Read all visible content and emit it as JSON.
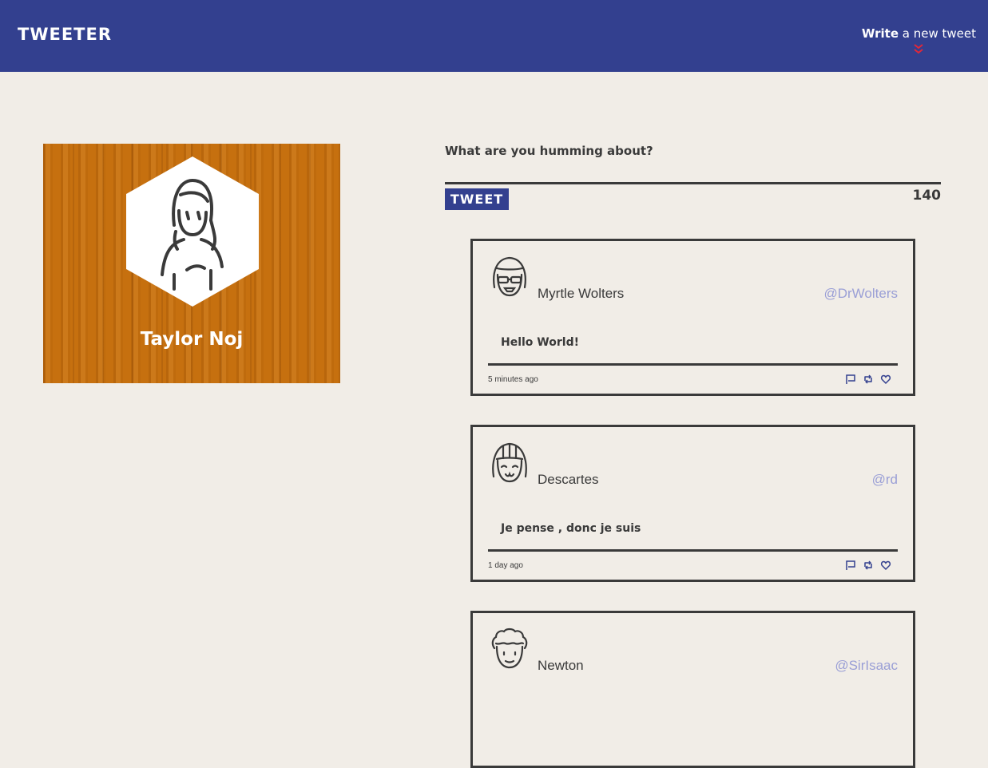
{
  "nav": {
    "brand": "TWEETER",
    "compose_toggle_bold": "Write",
    "compose_toggle_rest": " a new tweet",
    "chevron_icon": "double-chevron-down-icon",
    "accent_color": "#e0283a"
  },
  "profile": {
    "name": "Taylor Noj",
    "avatar_icon": "girl-avatar-icon"
  },
  "compose": {
    "prompt": "What are you humming about?",
    "button_label": "TWEET",
    "counter": "140"
  },
  "tweets": [
    {
      "name": "Myrtle Wolters",
      "handle": "@DrWolters",
      "text": "Hello World!",
      "time": "5 minutes ago",
      "avatar_icon": "sunglasses-avatar-icon"
    },
    {
      "name": "Descartes",
      "handle": "@rd",
      "text": "Je pense , donc je suis",
      "time": "1 day ago",
      "avatar_icon": "bangs-avatar-icon"
    },
    {
      "name": "Newton",
      "handle": "@SirIsaac",
      "avatar_icon": "curly-hair-avatar-icon"
    }
  ],
  "colors": {
    "header_bg": "#33408f",
    "page_bg": "#f1ede7",
    "handle": "#9a9fd6",
    "text": "#3a3a3a",
    "wood": "#c6700f"
  }
}
